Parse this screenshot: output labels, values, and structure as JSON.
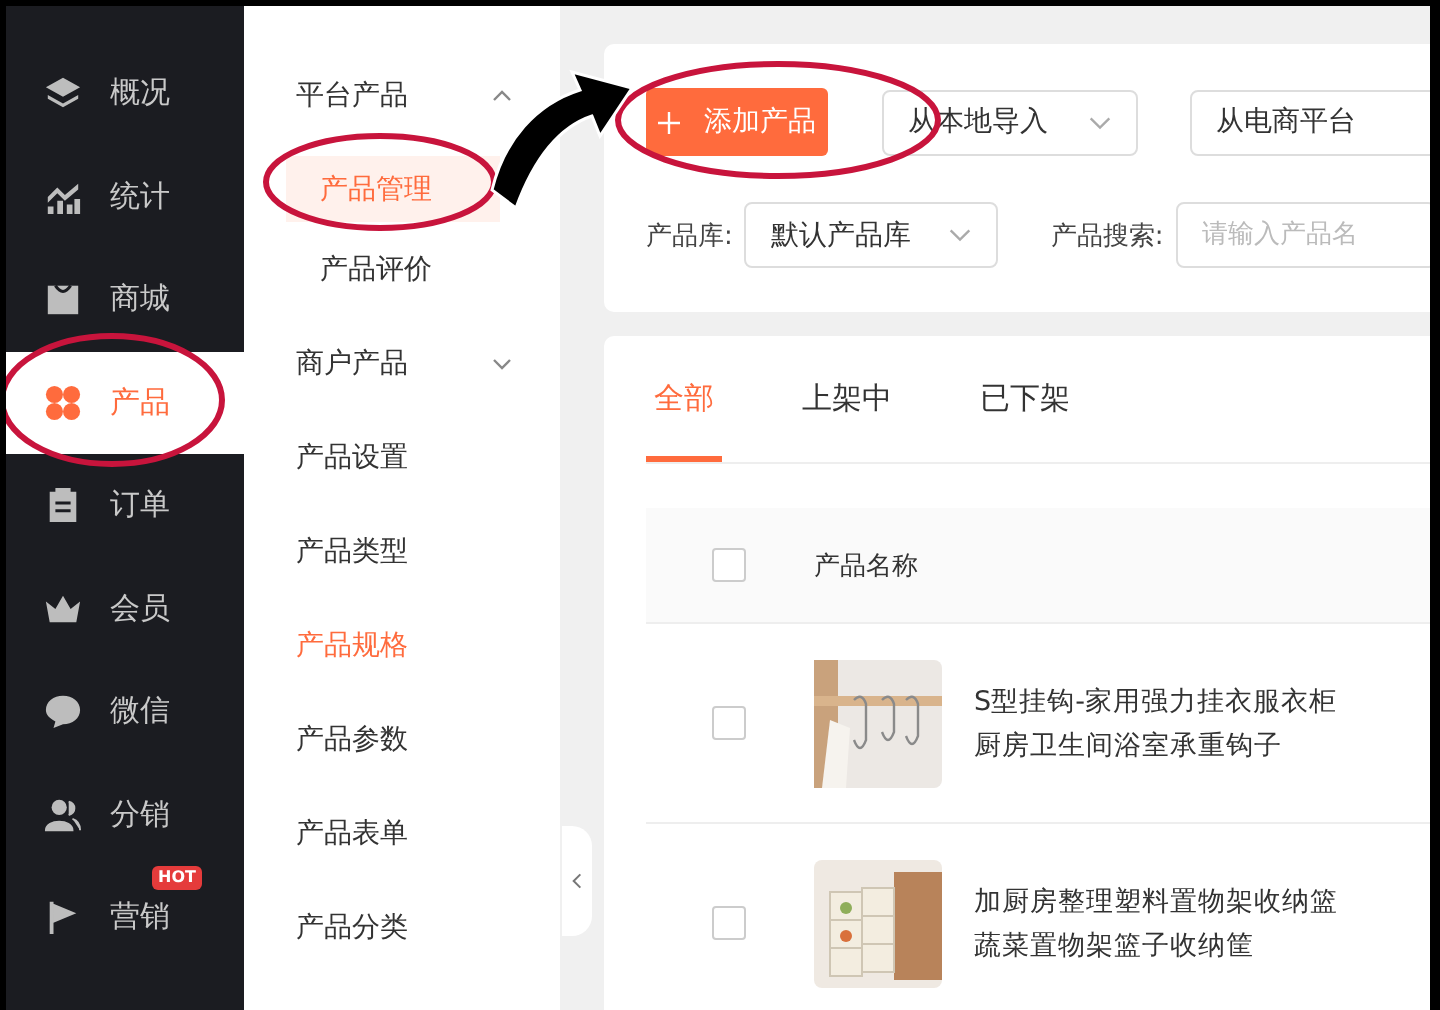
{
  "nav": [
    {
      "label": "概况",
      "selected": false
    },
    {
      "label": "统计",
      "selected": false
    },
    {
      "label": "商城",
      "selected": false
    },
    {
      "label": "产品",
      "selected": true
    },
    {
      "label": "订单",
      "selected": false
    },
    {
      "label": "会员",
      "selected": false
    },
    {
      "label": "微信",
      "selected": false
    },
    {
      "label": "分销",
      "selected": false
    },
    {
      "label": "营销",
      "selected": false,
      "badge": "HOT"
    }
  ],
  "submenu": [
    {
      "kind": "group",
      "label": "平台产品",
      "expanded": true,
      "children": [
        {
          "label": "产品管理",
          "selected": true
        },
        {
          "label": "产品评价",
          "selected": false
        }
      ]
    },
    {
      "kind": "group",
      "label": "商户产品",
      "expanded": false
    },
    {
      "kind": "link",
      "label": "产品设置",
      "highlighted": false
    },
    {
      "kind": "link",
      "label": "产品类型",
      "highlighted": false
    },
    {
      "kind": "link",
      "label": "产品规格",
      "highlighted": true
    },
    {
      "kind": "link",
      "label": "产品参数",
      "highlighted": false
    },
    {
      "kind": "link",
      "label": "产品表单",
      "highlighted": false
    },
    {
      "kind": "link",
      "label": "产品分类",
      "highlighted": false
    }
  ],
  "toolbar": {
    "add_button": "添加产品",
    "import_dropdowns": [
      "从本地导入",
      "从电商平台"
    ]
  },
  "filters": {
    "library_label": "产品库:",
    "library_value": "默认产品库",
    "search_label": "产品搜索:",
    "search_placeholder": "请输入产品名"
  },
  "tabs": [
    {
      "label": "全部",
      "selected": true
    },
    {
      "label": "上架中",
      "selected": false
    },
    {
      "label": "已下架",
      "selected": false
    }
  ],
  "table": {
    "columns": [
      "产品名称"
    ],
    "header_checked": false,
    "rows": [
      {
        "checked": false,
        "name": "S型挂钩-家用强力挂衣服衣柜厨房卫生间浴室承重钩子"
      },
      {
        "checked": false,
        "name": "加厨房整理塑料置物架收纳篮蔬菜置物架篮子收纳筐"
      }
    ]
  }
}
